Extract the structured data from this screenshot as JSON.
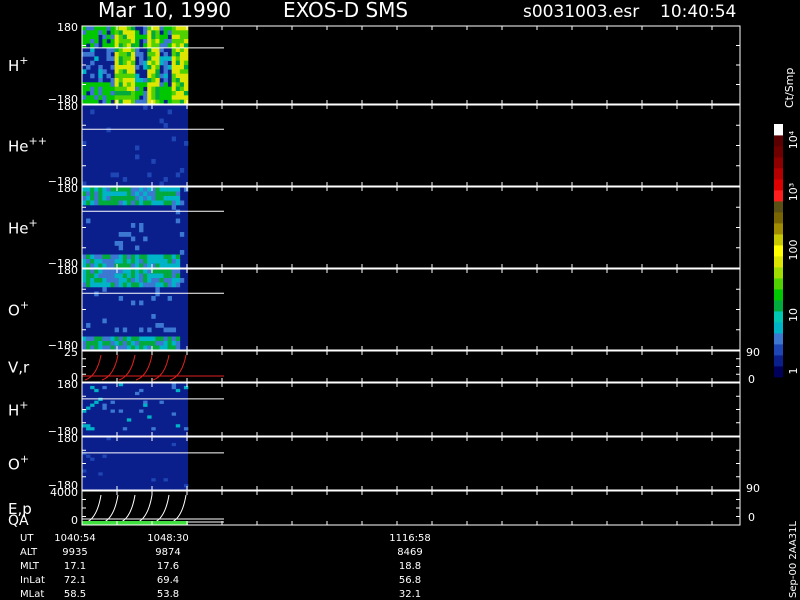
{
  "header": {
    "date": "Mar 10, 1990",
    "mission": "EXOS-D SMS",
    "file": "s0031003.esr",
    "time": "10:40:54"
  },
  "colorbar": {
    "unit": "Ct/Smp",
    "labels": [
      "1",
      "10",
      "100",
      "10³",
      "10⁴"
    ],
    "colors": [
      "#00005a",
      "#0a1e8c",
      "#1e46b4",
      "#3c78d2",
      "#00b4c8",
      "#00c8b4",
      "#00aa3c",
      "#00c800",
      "#50d200",
      "#a0dc00",
      "#dce600",
      "#ffff00",
      "#c8c800",
      "#a08c00",
      "#786400",
      "#5a5014",
      "#ff1e1e",
      "#dc0000",
      "#b40000",
      "#8c0000",
      "#6e0000",
      "#5a0000",
      "#ffffff"
    ]
  },
  "side_labels": {
    "p90": "90",
    "p0": "0",
    "version": "Sep-00 2AA31L"
  },
  "footer": {
    "rows": [
      {
        "label": "UT",
        "values": [
          "1040:54",
          "1048:30",
          "1116:58"
        ]
      },
      {
        "label": "ALT",
        "values": [
          "9935",
          "9874",
          "8469"
        ]
      },
      {
        "label": "MLT",
        "values": [
          "17.1",
          "17.6",
          "18.8"
        ]
      },
      {
        "label": "InLat",
        "values": [
          "72.1",
          "69.4",
          "56.8"
        ]
      },
      {
        "label": "MLat",
        "values": [
          "58.5",
          "53.8",
          "32.1"
        ]
      }
    ]
  },
  "chart_data": {
    "type": "heatmap",
    "x_ticks_ut": [
      "1040:54",
      "1048:30",
      "1116:58"
    ],
    "panels": [
      {
        "id": "h-plus",
        "label": "H",
        "sup": "+",
        "ymax": "180",
        "ymin": "−180",
        "style": "hplus",
        "ref": 0.28
      },
      {
        "id": "he-plus-plus",
        "label": "He",
        "sup": "++",
        "ymax": "180",
        "ymin": "−180",
        "style": "hepp",
        "ref": 0.3
      },
      {
        "id": "he-plus",
        "label": "He",
        "sup": "+",
        "ymax": "180",
        "ymin": "−180",
        "style": "heplus",
        "ref": 0.3
      },
      {
        "id": "o-plus",
        "label": "O",
        "sup": "+",
        "ymax": "180",
        "ymin": "−180",
        "style": "oplus",
        "ref": 0.3
      },
      {
        "id": "v-r",
        "label": "V,r",
        "sup": "",
        "ymax": "25",
        "ymin": "0",
        "style": "vr"
      },
      {
        "id": "h-plus-2",
        "label": "H",
        "sup": "+",
        "ymax": "180",
        "ymin": "−180",
        "style": "hplus2",
        "ref": 0.3
      },
      {
        "id": "o-plus-2",
        "label": "O",
        "sup": "+",
        "ymax": "180",
        "ymin": "−180",
        "style": "oplus2",
        "ref": 0.3
      },
      {
        "id": "e-p",
        "label": "E,p",
        "sup": "",
        "ymax": "4000",
        "ymin": "0",
        "style": "ep",
        "extra": "QA"
      }
    ]
  }
}
